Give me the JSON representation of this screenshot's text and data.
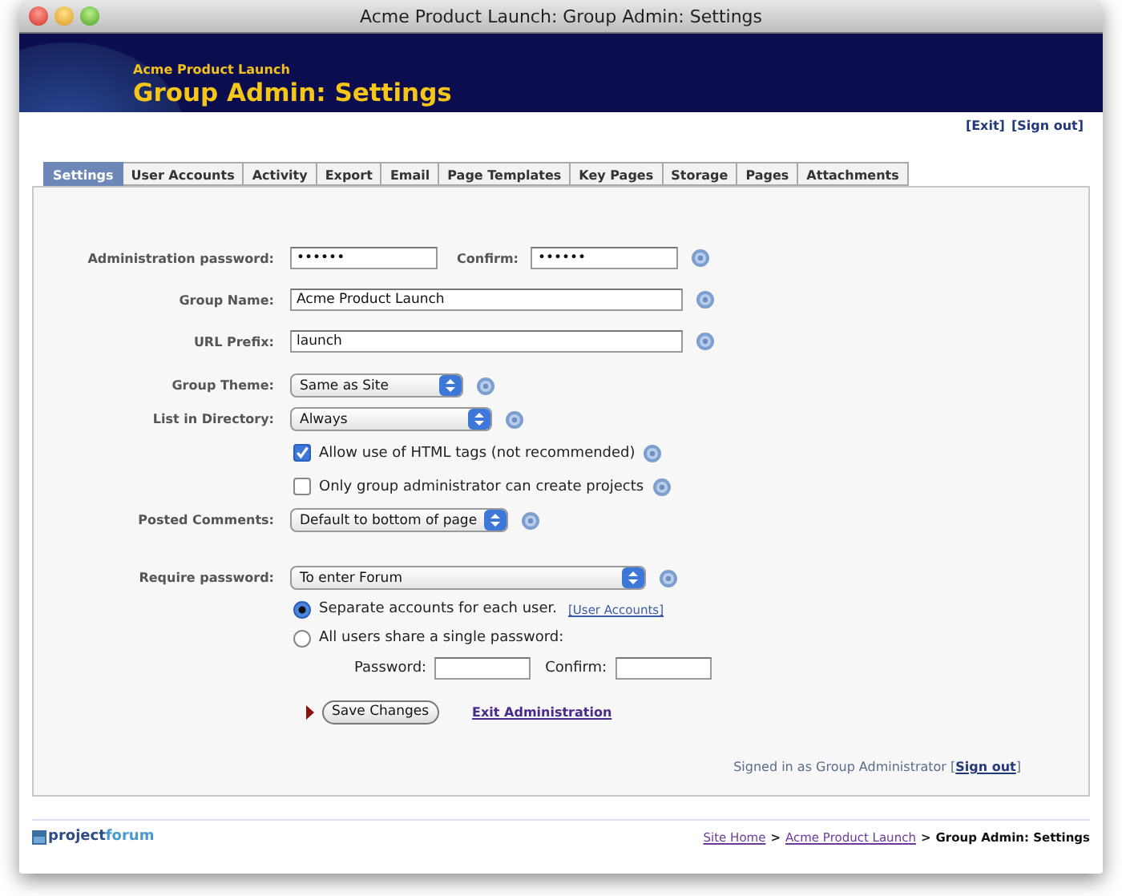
{
  "window": {
    "title": "Acme Product Launch: Group Admin: Settings"
  },
  "header": {
    "site_name": "Acme Product Launch",
    "title": "Group Admin: Settings"
  },
  "top_links": [
    "[Exit]",
    "[Sign out]"
  ],
  "tabs": [
    {
      "label": "Settings",
      "selected": true
    },
    {
      "label": "User Accounts",
      "selected": false
    },
    {
      "label": "Activity",
      "selected": false
    },
    {
      "label": "Export",
      "selected": false
    },
    {
      "label": "Email",
      "selected": false
    },
    {
      "label": "Page Templates",
      "selected": false
    },
    {
      "label": "Key Pages",
      "selected": false
    },
    {
      "label": "Storage",
      "selected": false
    },
    {
      "label": "Pages",
      "selected": false
    },
    {
      "label": "Attachments",
      "selected": false
    }
  ],
  "form": {
    "admin_password": {
      "label": "Administration password:",
      "value": "••••••"
    },
    "admin_confirm": {
      "label": "Confirm:",
      "value": "••••••"
    },
    "group_name": {
      "label": "Group Name:",
      "value": "Acme Product Launch"
    },
    "url_prefix": {
      "label": "URL Prefix:",
      "value": "launch"
    },
    "group_theme": {
      "label": "Group Theme:",
      "value": "Same as Site"
    },
    "list_in_directory": {
      "label": "List in Directory:",
      "value": "Always"
    },
    "options": [
      {
        "label": "Allow use of HTML tags (not recommended)",
        "checked": true
      },
      {
        "label": "Only group administrator can create projects",
        "checked": false
      }
    ],
    "posted_comments": {
      "label": "Posted Comments:",
      "value": "Default to bottom of page"
    },
    "require_password": {
      "label": "Require password:",
      "value": "To enter Forum"
    },
    "access": [
      {
        "label": "Separate accounts for each user.",
        "selected": true,
        "link": "[User Accounts]"
      },
      {
        "label": "All users share a single password:",
        "selected": false
      }
    ],
    "shared_password": [
      {
        "label": "Password:"
      },
      {
        "label": "Confirm:"
      }
    ],
    "save_button": "Save Changes",
    "exit_link": "Exit Administration"
  },
  "status": {
    "text_before": "Signed in as Group Administrator [",
    "link": "Sign out",
    "text_after": "]"
  },
  "footer": {
    "logo_part_1": "project",
    "logo_part_2": "forum",
    "breadcrumb": [
      {
        "kind": "link",
        "label": "Site Home"
      },
      {
        "kind": "separator",
        "label": ">"
      },
      {
        "kind": "link",
        "label": "Acme Product Launch"
      },
      {
        "kind": "separator",
        "label": ">"
      },
      {
        "kind": "current",
        "label": "Group Admin: Settings"
      }
    ]
  }
}
